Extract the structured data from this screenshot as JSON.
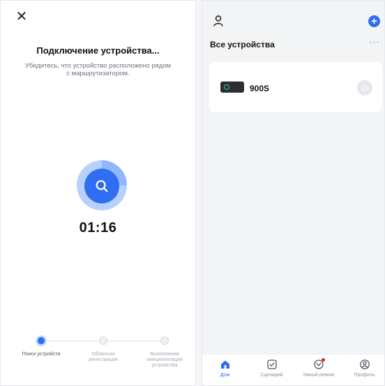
{
  "left": {
    "close_icon": "close-icon",
    "title": "Подключение устройства...",
    "subtitle": "Убедитесь, что устройство расположено рядом с маршрутизатором.",
    "timer": "01:16",
    "steps": [
      {
        "label": "Поиск устройств",
        "state": "active"
      },
      {
        "label": "Облачная регистрация",
        "state": "inactive"
      },
      {
        "label": "Выполнение инициализации устройства",
        "state": "inactive"
      }
    ]
  },
  "right": {
    "section_title": "Все устройства",
    "more_label": "···",
    "add_label": "+",
    "device": {
      "name": "900S",
      "power_state": "off"
    },
    "nav": [
      {
        "label": "Дом",
        "active": true,
        "icon": "home-icon"
      },
      {
        "label": "Сценарий",
        "active": false,
        "icon": "checkbox-icon"
      },
      {
        "label": "Умный режим",
        "active": false,
        "icon": "smart-mode-icon",
        "badge": true
      },
      {
        "label": "Профиль",
        "active": false,
        "icon": "profile-icon"
      }
    ]
  },
  "colors": {
    "accent": "#2f6ef2",
    "accent_light": "#b7d1ff",
    "badge": "#e02424"
  }
}
